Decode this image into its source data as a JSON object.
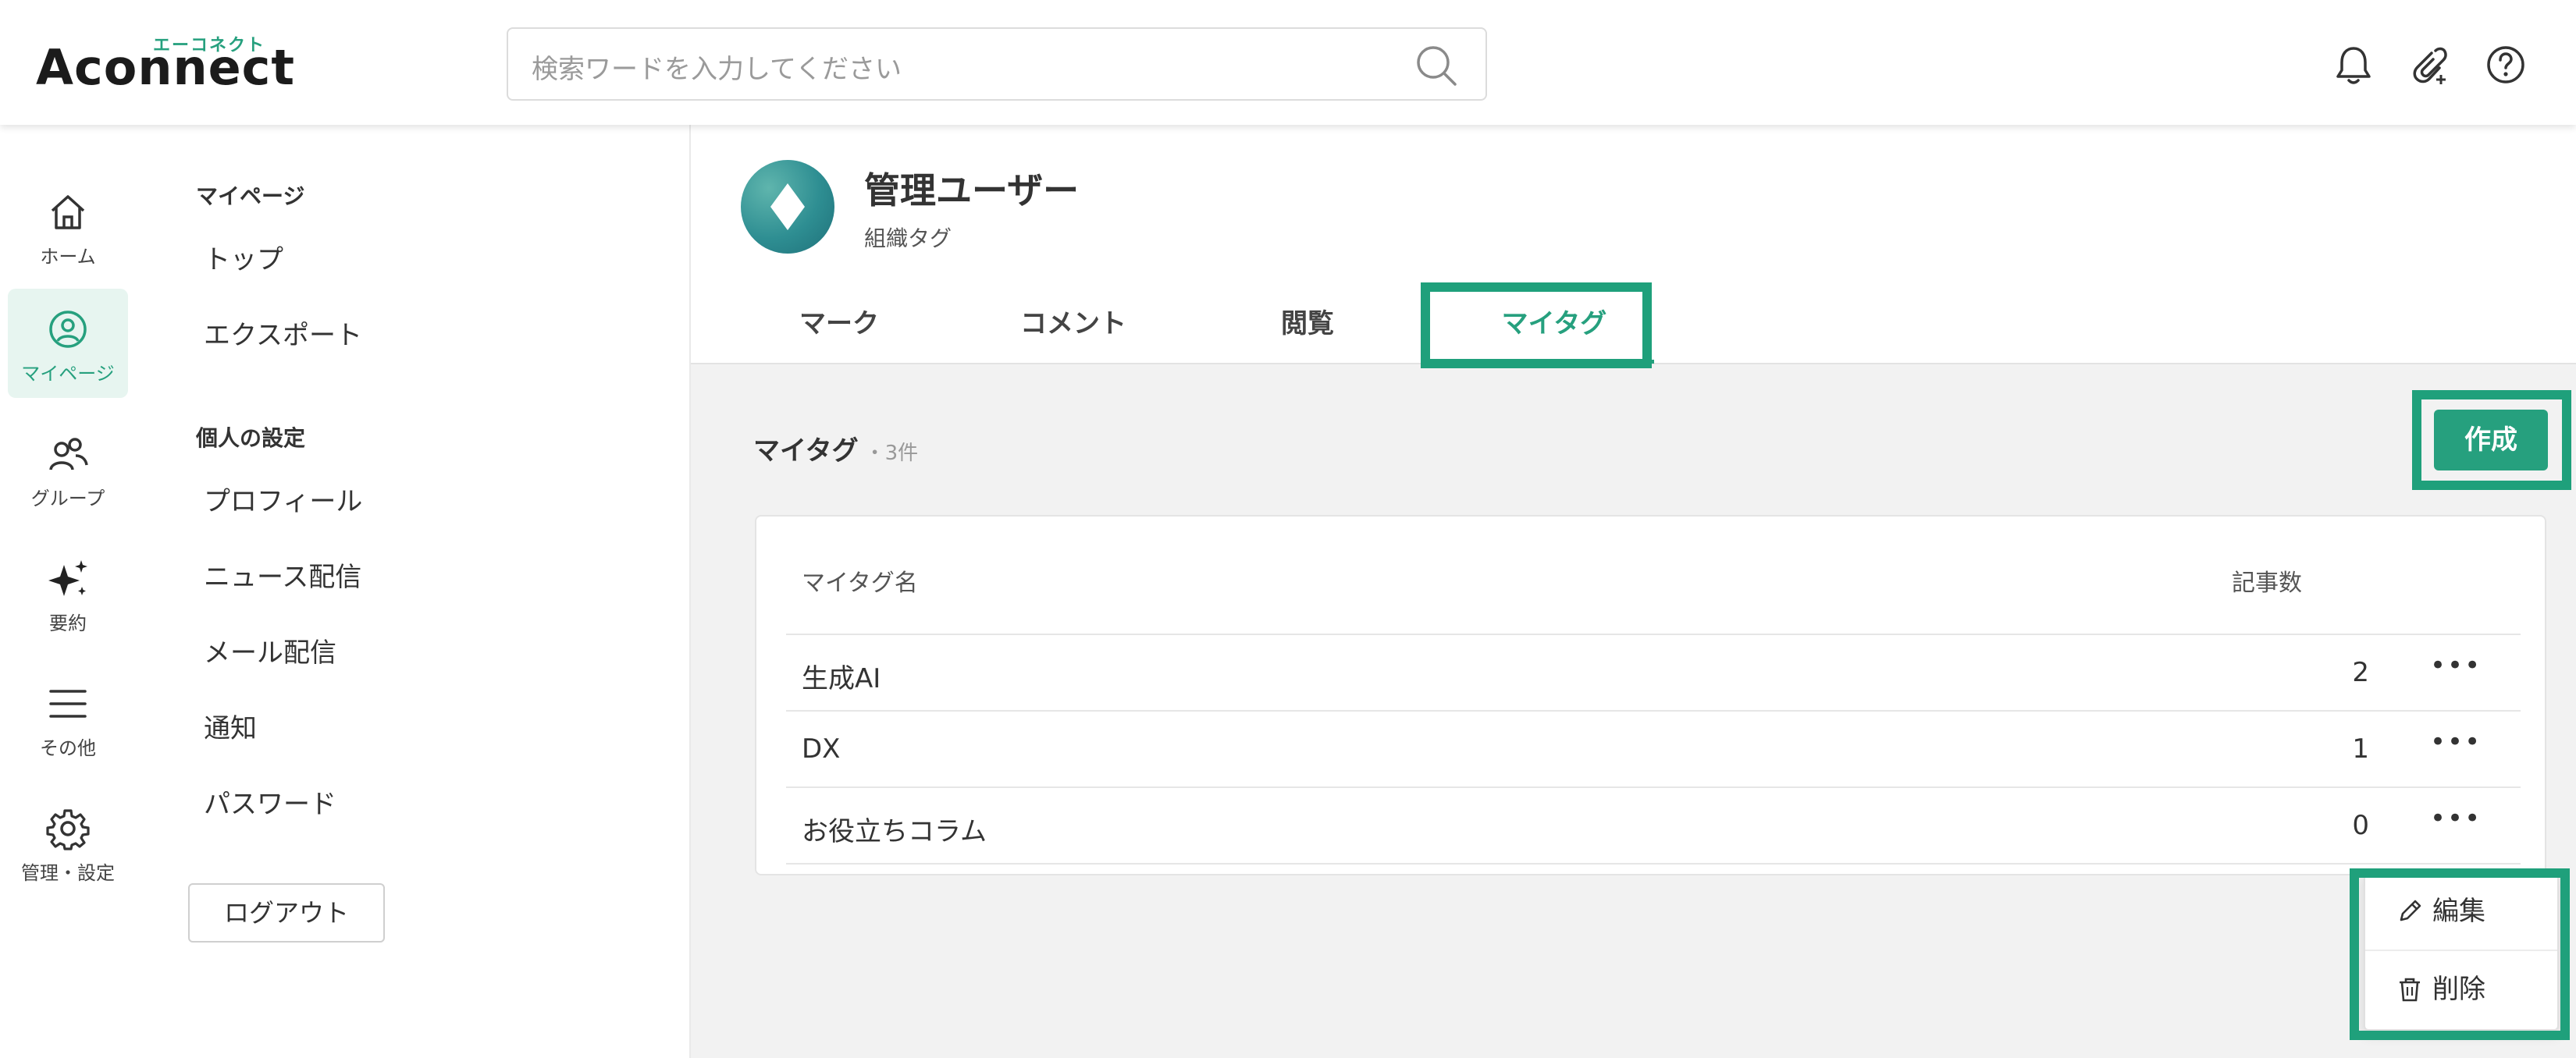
{
  "app": {
    "logo_kana": "エーコネクト",
    "logo_text": "connect",
    "logo_initial": "A",
    "brand_color": "#26a07e"
  },
  "header": {
    "search_placeholder": "検索ワードを入力してください",
    "icons": [
      "bell-icon",
      "paperclip-plus-icon",
      "help-icon"
    ]
  },
  "rail": {
    "items": [
      {
        "label": "ホーム",
        "icon": "home-icon"
      },
      {
        "label": "マイページ",
        "icon": "user-circle-icon",
        "active": true
      },
      {
        "label": "グループ",
        "icon": "group-icon"
      },
      {
        "label": "要約",
        "icon": "sparkle-icon"
      },
      {
        "label": "その他",
        "icon": "menu-icon"
      },
      {
        "label": "管理・設定",
        "icon": "gear-icon"
      }
    ]
  },
  "sidebar": {
    "mypage_title": "マイページ",
    "mypage_items": [
      "トップ",
      "エクスポート"
    ],
    "settings_title": "個人の設定",
    "settings_items": [
      "プロフィール",
      "ニュース配信",
      "メール配信",
      "通知",
      "パスワード"
    ],
    "logout": "ログアウト"
  },
  "profile": {
    "name": "管理ユーザー",
    "tag": "組織タグ"
  },
  "tabs": [
    {
      "label": "マーク"
    },
    {
      "label": "コメント"
    },
    {
      "label": "閲覧"
    },
    {
      "label": "マイタグ",
      "active": true
    }
  ],
  "mytags": {
    "title": "マイタグ",
    "count": "・3件",
    "create_button": "作成",
    "columns": {
      "name": "マイタグ名",
      "articles": "記事数"
    },
    "rows": [
      {
        "name": "生成AI",
        "count": "2"
      },
      {
        "name": "DX",
        "count": "1"
      },
      {
        "name": "お役立ちコラム",
        "count": "0"
      }
    ],
    "row_menu": {
      "edit": "編集",
      "delete": "削除"
    }
  },
  "highlight_color": "#1fa07b"
}
